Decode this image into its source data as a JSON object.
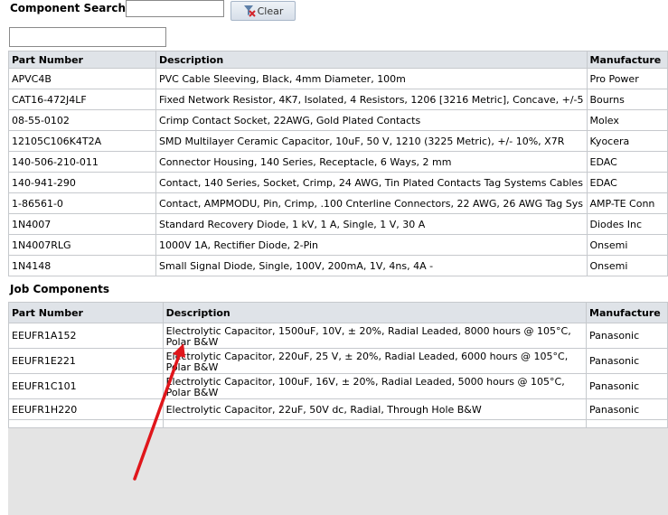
{
  "search": {
    "label": "Component Search",
    "value": "",
    "clear_label": "Clear",
    "filter_value": ""
  },
  "components": {
    "columns": [
      "Part Number",
      "Description",
      "Manufacture"
    ],
    "rows": [
      [
        "APVC4B",
        "PVC Cable Sleeving, Black, 4mm Diameter, 100m",
        "Pro Power"
      ],
      [
        "CAT16-472J4LF",
        "Fixed Network Resistor, 4K7, Isolated, 4 Resistors, 1206 [3216 Metric], Concave, +/-5",
        "Bourns"
      ],
      [
        "08-55-0102",
        "Crimp Contact Socket, 22AWG, Gold Plated Contacts",
        "Molex"
      ],
      [
        "12105C106K4T2A",
        "SMD Multilayer Ceramic Capacitor, 10uF, 50 V, 1210 (3225 Metric), +/- 10%, X7R",
        "Kyocera"
      ],
      [
        "140-506-210-011",
        "Connector Housing, 140 Series, Receptacle, 6 Ways, 2 mm",
        "EDAC"
      ],
      [
        "140-941-290",
        "Contact, 140 Series, Socket, Crimp, 24 AWG, Tin Plated Contacts Tag Systems Cables",
        "EDAC"
      ],
      [
        "1-86561-0",
        "Contact, AMPMODU, Pin, Crimp, .100 Cnterline Connectors, 22 AWG, 26 AWG Tag Sys",
        "AMP-TE Conn"
      ],
      [
        "1N4007",
        "Standard Recovery Diode, 1 kV, 1 A, Single, 1 V, 30 A",
        "Diodes Inc"
      ],
      [
        "1N4007RLG",
        "1000V 1A, Rectifier Diode, 2-Pin",
        "Onsemi"
      ],
      [
        "1N4148",
        "Small Signal Diode, Single, 100V, 200mA, 1V, 4ns, 4A -",
        "Onsemi"
      ]
    ]
  },
  "job_components": {
    "title": "Job Components",
    "columns": [
      "Part Number",
      "Description",
      "Manufacture"
    ],
    "rows": [
      [
        "EEUFR1A152",
        "Electrolytic Capacitor, 1500uF, 10V, ± 20%, Radial Leaded, 8000 hours @ 105°C, Polar B&W",
        "Panasonic"
      ],
      [
        "EEUFR1E221",
        "Electrolytic Capacitor, 220uF, 25 V, ± 20%, Radial Leaded, 6000 hours @ 105°C, Polar B&W",
        "Panasonic"
      ],
      [
        "EEUFR1C101",
        "Electrolytic Capacitor, 100uF, 16V, ± 20%, Radial Leaded, 5000 hours @ 105°C, Polar B&W",
        "Panasonic"
      ],
      [
        "EEUFR1H220",
        "Electrolytic Capacitor, 22uF, 50V dc, Radial, Through Hole B&W",
        "Panasonic"
      ],
      [
        "",
        "",
        ""
      ]
    ]
  },
  "colors": {
    "header_bg": "#dfe3e8",
    "grid_border": "#c6c9cd",
    "annotation_arrow": "#e0161b"
  },
  "icons": {
    "clear": "filter-clear-icon"
  }
}
